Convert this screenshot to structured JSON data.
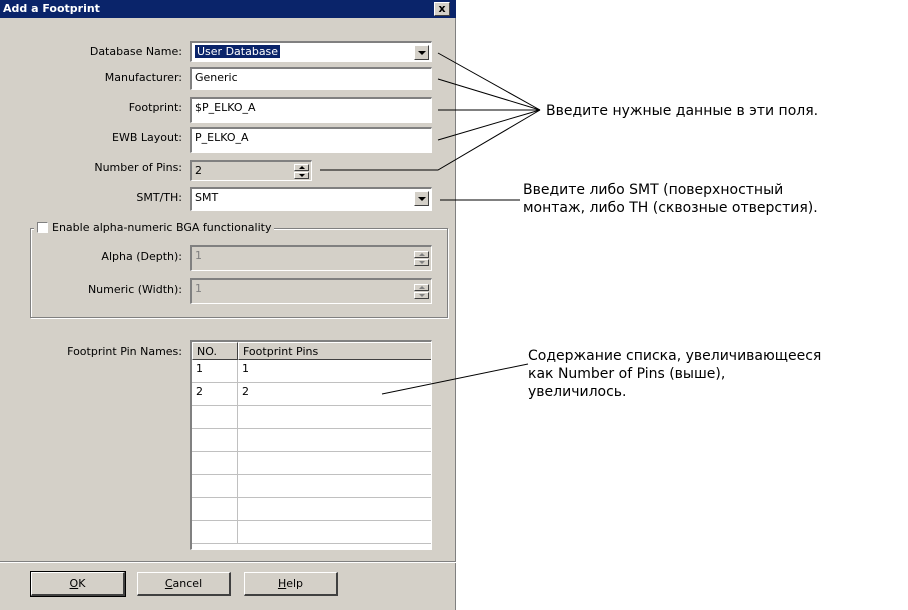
{
  "window": {
    "title": "Add a Footprint",
    "close_glyph": "x"
  },
  "fields": {
    "database_name": {
      "label": "Database Name:",
      "value": "User Database"
    },
    "manufacturer": {
      "label": "Manufacturer:",
      "value": "Generic"
    },
    "footprint": {
      "label": "Footprint:",
      "value": "$P_ELKO_A"
    },
    "ewb_layout": {
      "label": "EWB Layout:",
      "value": "P_ELKO_A"
    },
    "number_of_pins": {
      "label": "Number of Pins:",
      "value": "2"
    },
    "smt_th": {
      "label": "SMT/TH:",
      "value": "SMT"
    }
  },
  "bga": {
    "checkbox_label": "Enable alpha-numeric BGA functionality",
    "checked": false,
    "alpha_label": "Alpha (Depth):",
    "alpha_value": "1",
    "numeric_label": "Numeric (Width):",
    "numeric_value": "1"
  },
  "pin_names": {
    "label": "Footprint Pin Names:",
    "columns": [
      "NO.",
      "Footprint Pins"
    ],
    "rows": [
      [
        "1",
        "1"
      ],
      [
        "2",
        "2"
      ],
      [
        "",
        ""
      ],
      [
        "",
        ""
      ],
      [
        "",
        ""
      ],
      [
        "",
        ""
      ],
      [
        "",
        ""
      ],
      [
        "",
        ""
      ]
    ]
  },
  "buttons": {
    "ok_mnemonic": "O",
    "ok_rest": "K",
    "cancel_mnemonic": "C",
    "cancel_rest": "ancel",
    "help_mnemonic": "H",
    "help_rest": "elp"
  },
  "annotations": {
    "fields_note": "Введите нужные данные в эти поля.",
    "smt_note_line1": "Введите либо SMT (поверхностный",
    "smt_note_line2": "монтаж, либо TH (сквозные отверстия).",
    "list_note_line1": "Содержание списка, увеличивающееся",
    "list_note_line2": "как Number of Pins (выше),",
    "list_note_line3": "увеличилось."
  },
  "colors": {
    "titlebar": "#0a246a",
    "dialog_bg": "#d4d0c8",
    "selection": "#0a246a"
  }
}
